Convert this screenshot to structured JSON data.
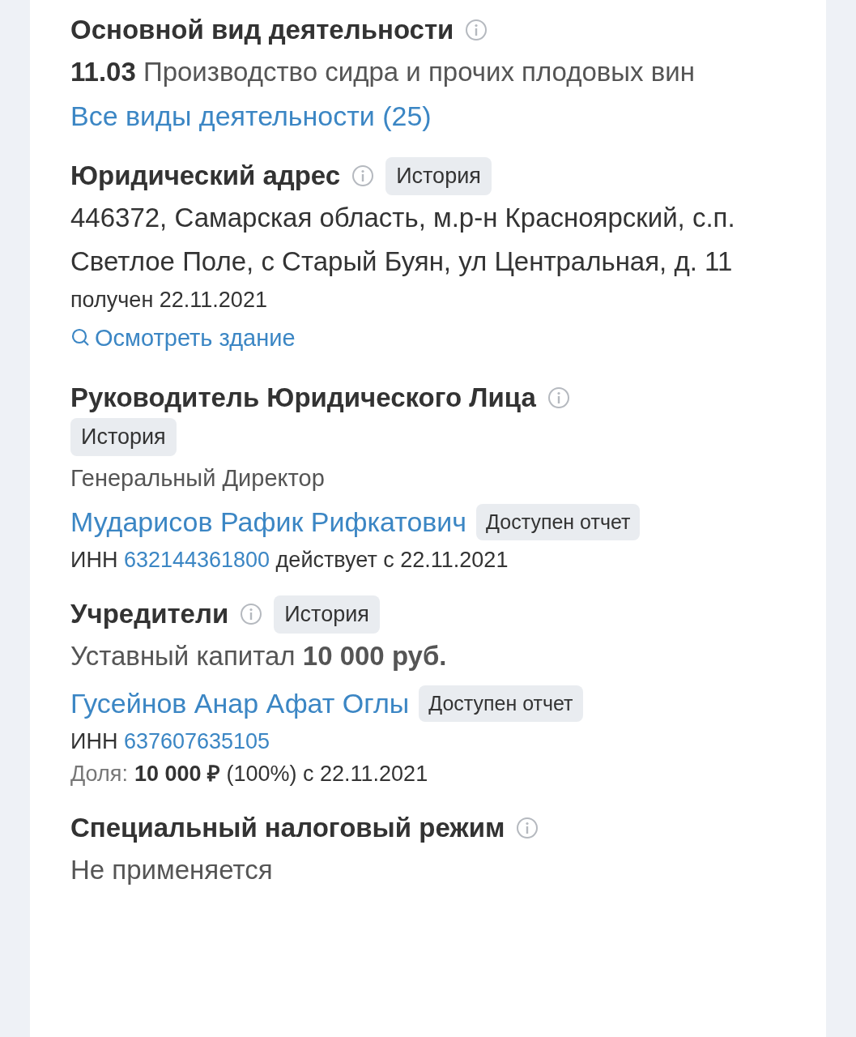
{
  "main_activity": {
    "title": "Основной вид деятельности",
    "code": "11.03",
    "name": "Производство сидра и прочих плодовых вин",
    "all_link": "Все виды деятельности (25)"
  },
  "legal_address": {
    "title": "Юридический адрес",
    "history": "История",
    "address": "446372, Самарская область, м.р-н Красноярский, с.п. Светлое Поле, с Старый Буян, ул Центральная, д. 11",
    "received": "получен 22.11.2021",
    "building_link": "Осмотреть здание"
  },
  "head": {
    "title": "Руководитель Юридического Лица",
    "history": "История",
    "position": "Генеральный Директор",
    "name": "Мударисов Рафик Рифкатович",
    "badge": "Доступен отчет",
    "inn_label": "ИНН",
    "inn": "632144361800",
    "since": "действует с 22.11.2021"
  },
  "founders": {
    "title": "Учредители",
    "history": "История",
    "capital": "Уставный капитал **10 000 руб.**",
    "items": [
      {
        "name": "Гусейнов Анар Афат Оглы",
        "badge": "Доступен отчет",
        "inn_label": "ИНН",
        "inn": "637607635105",
        "share_label": "Доля:",
        "share": "**10 000 ₽** (100%) с 22.11.2021"
      }
    ]
  },
  "tax_regime": {
    "title": "Специальный налоговый режим",
    "value": "Не применяется"
  }
}
